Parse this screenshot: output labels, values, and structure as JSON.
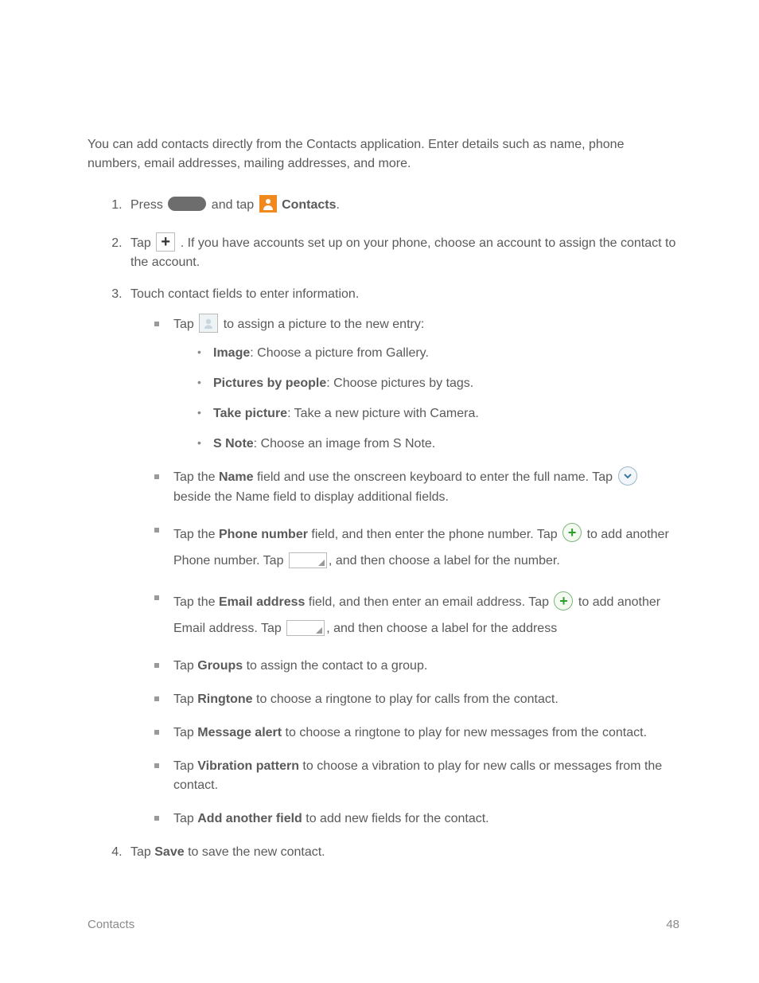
{
  "intro": "You can add contacts directly from the Contacts application. Enter details such as name, phone numbers, email addresses, mailing addresses, and more.",
  "steps": {
    "s1": {
      "a": "Press ",
      "b": " and tap ",
      "c": " ",
      "bold": "Contacts",
      "d": "."
    },
    "s2": {
      "a": "Tap ",
      "b": ". If you have accounts set up on your phone, choose an account to assign the contact to the account."
    },
    "s3": "Touch contact fields to enter information.",
    "s4": {
      "a": "Tap ",
      "bold": "Save",
      "b": " to save the new contact."
    }
  },
  "fields": {
    "photo": {
      "a": "Tap ",
      "b": " to assign a picture to the new entry:"
    },
    "photo_opts": {
      "image": {
        "bold": "Image",
        "t": ": Choose a picture from Gallery."
      },
      "pbp": {
        "bold": "Pictures by people",
        "t": ": Choose pictures by tags."
      },
      "take": {
        "bold": "Take picture",
        "t": ": Take a new picture with Camera."
      },
      "snote": {
        "bold": "S Note",
        "t": ": Choose an image from S Note."
      }
    },
    "name": {
      "a": "Tap the ",
      "bold": "Name",
      "b": " field and use the onscreen keyboard to enter the full name. Tap ",
      "c": " beside the Name field to display additional fields."
    },
    "phone": {
      "a": "Tap the ",
      "bold": "Phone number",
      "b": " field, and then enter the phone number. Tap ",
      "c": " to add another Phone number. Tap ",
      "d": ", and then choose a label for the number."
    },
    "email": {
      "a": "Tap the ",
      "bold": "Email address",
      "b": " field, and then enter an email address. Tap ",
      "c": " to add another Email address. Tap ",
      "d": ", and then choose a label for the address"
    },
    "groups": {
      "a": "Tap ",
      "bold": "Groups",
      "b": " to assign the contact to a group."
    },
    "ringtone": {
      "a": "Tap ",
      "bold": "Ringtone",
      "b": " to choose a ringtone to play for calls from the contact."
    },
    "msgalert": {
      "a": "Tap ",
      "bold": "Message alert",
      "b": " to choose a ringtone to play for new messages from the contact."
    },
    "vib": {
      "a": "Tap ",
      "bold": "Vibration pattern",
      "b": " to choose a vibration to play for new calls or messages from the contact."
    },
    "addfield": {
      "a": "Tap ",
      "bold": "Add another field",
      "b": " to add new fields for the contact."
    }
  },
  "footer": {
    "section": "Contacts",
    "page": "48"
  }
}
